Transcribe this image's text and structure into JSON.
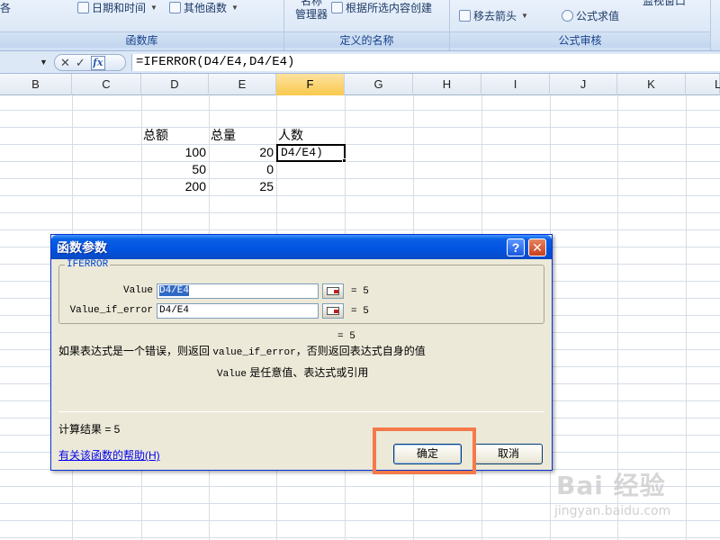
{
  "ribbon": {
    "partial_left": "各",
    "date_time": "日期和时间",
    "other_functions": "其他函数",
    "name_manager_l1": "名称",
    "name_manager_l2": "管理器",
    "create_from_selection": "根据所选内容创建",
    "remove_arrows": "移去箭头",
    "evaluate_formula": "公式求值",
    "partial_right": "监视窗口",
    "group_function_library": "函数库",
    "group_defined_names": "定义的名称",
    "group_formula_auditing": "公式审核"
  },
  "formula_bar": {
    "cancel": "✕",
    "enter": "✓",
    "fx": "fx",
    "formula": "=IFERROR(D4/E4,D4/E4)"
  },
  "columns": [
    "B",
    "C",
    "D",
    "E",
    "F",
    "G",
    "H",
    "I",
    "J",
    "K",
    "L"
  ],
  "active_column": "F",
  "cells": {
    "d3": "总额",
    "e3": "总量",
    "f3": "人数",
    "d4": "100",
    "e4": "20",
    "d5": "50",
    "e5": "0",
    "d6": "200",
    "e6": "25",
    "f4_edit": "D4/E4)"
  },
  "dialog": {
    "title": "函数参数",
    "help": "?",
    "close": "✕",
    "function_name": "IFERROR",
    "arg1_label": "Value",
    "arg1_value": "D4/E4",
    "arg1_result": "= 5",
    "arg2_label": "Value_if_error",
    "arg2_value": "D4/E4",
    "arg2_result": "= 5",
    "result_eq": "= 5",
    "description_a": "如果表达式是一个错误，则返回 ",
    "description_b": "value_if_error",
    "description_c": "，否则返回表达式自身的值",
    "arg_desc_a": "Value",
    "arg_desc_b": " 是任意值、表达式或引用",
    "calc_result": "计算结果 = 5",
    "help_link": "有关该函数的帮助(H)",
    "ok": "确定",
    "cancel": "取消"
  },
  "watermark": {
    "text": "Bai 经验",
    "url": "jingyan.baidu.com"
  }
}
